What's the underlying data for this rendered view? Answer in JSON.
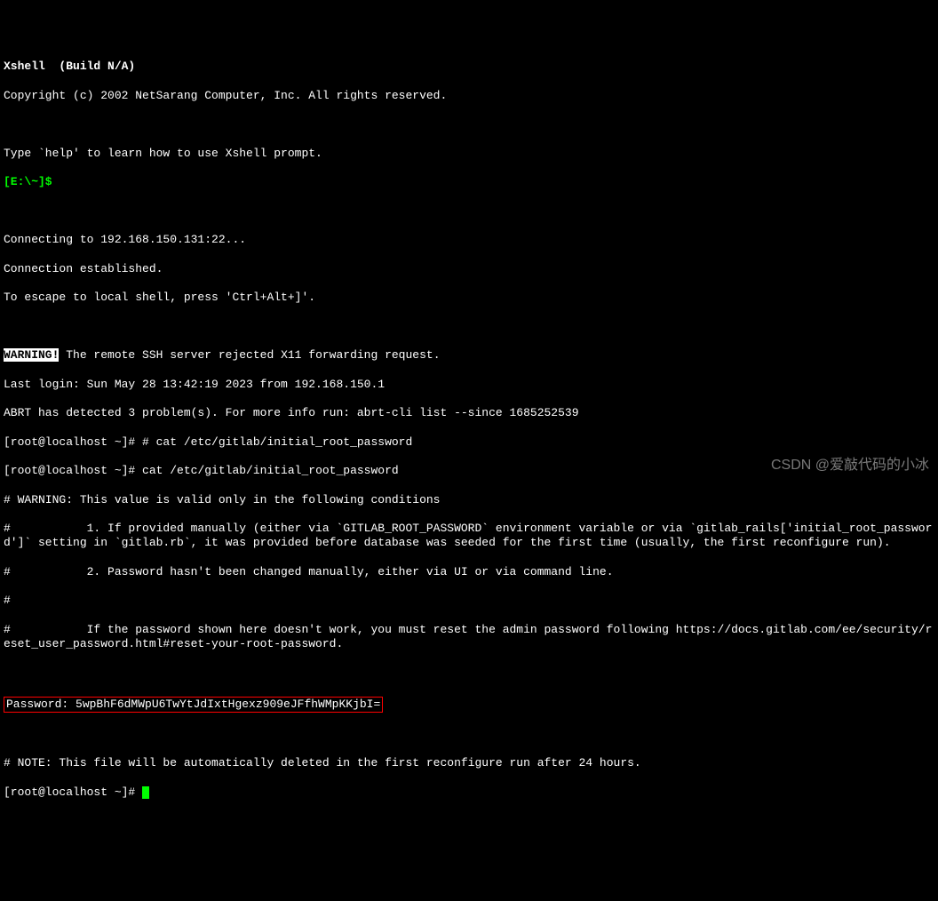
{
  "header": {
    "title": "Xshell  (Build N/A)",
    "copyright": "Copyright (c) 2002 NetSarang Computer, Inc. All rights reserved."
  },
  "intro": {
    "help_line": "Type `help' to learn how to use Xshell prompt.",
    "local_prompt": "[E:\\~]$ "
  },
  "connection": {
    "connecting": "Connecting to 192.168.150.131:22...",
    "established": "Connection established.",
    "escape_hint": "To escape to local shell, press 'Ctrl+Alt+]'."
  },
  "ssh": {
    "warning_label": "WARNING!",
    "warning_text": " The remote SSH server rejected X11 forwarding request.",
    "last_login": "Last login: Sun May 28 13:42:19 2023 from 192.168.150.1",
    "abrt": "ABRT has detected 3 problem(s). For more info run: abrt-cli list --since 1685252539"
  },
  "cmds": {
    "prompt": "[root@localhost ~]# ",
    "cmd1": "# cat /etc/gitlab/initial_root_password",
    "cmd2": "cat /etc/gitlab/initial_root_password"
  },
  "file": {
    "warn_line": "# WARNING: This value is valid only in the following conditions",
    "cond1": "#           1. If provided manually (either via `GITLAB_ROOT_PASSWORD` environment variable or via `gitlab_rails['initial_root_password']` setting in `gitlab.rb`, it was provided before database was seeded for the first time (usually, the first reconfigure run).",
    "cond2": "#           2. Password hasn't been changed manually, either via UI or via command line.",
    "hash": "#",
    "reset_note": "#           If the password shown here doesn't work, you must reset the admin password following https://docs.gitlab.com/ee/security/reset_user_password.html#reset-your-root-password.",
    "password_line": "Password: 5wpBhF6dMWpU6TwYtJdIxtHgexz909eJFfhWMpKKjbI=",
    "note": "# NOTE: This file will be automatically deleted in the first reconfigure run after 24 hours.",
    "final_prompt": "[root@localhost ~]# "
  },
  "watermark": "CSDN @爱敲代码的小冰"
}
